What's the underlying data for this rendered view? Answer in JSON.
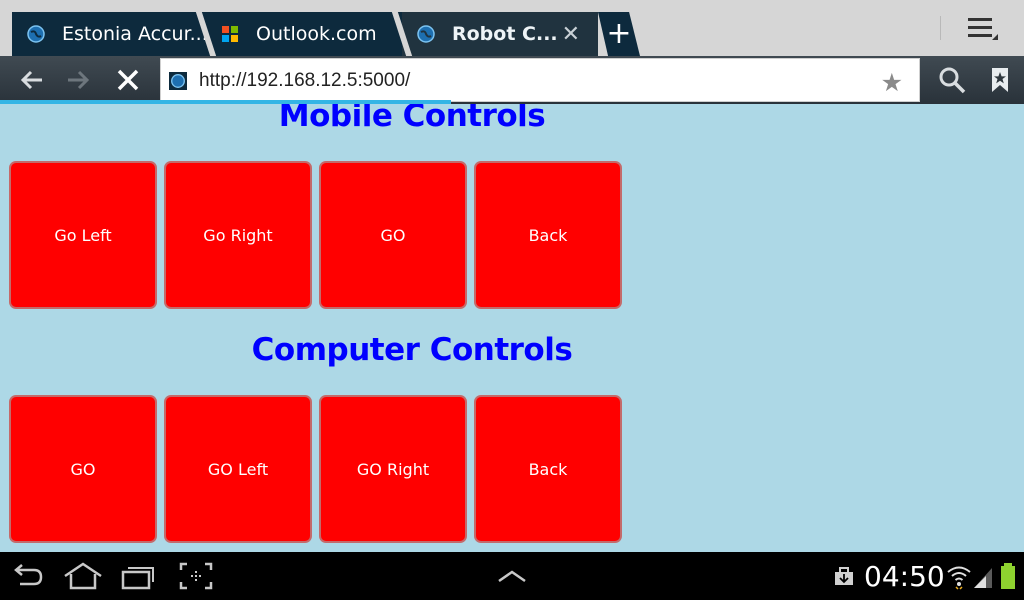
{
  "browser": {
    "tabs": [
      {
        "title": "Estonia Accur...",
        "active": false
      },
      {
        "title": "Outlook.com",
        "active": false
      },
      {
        "title": "Robot C...",
        "active": true
      }
    ],
    "new_tab_symbol": "+",
    "close_tab_symbol": "✕",
    "url": "http://192.168.12.5:5000/",
    "icons": {
      "back": "back-arrow-icon",
      "forward": "forward-arrow-icon",
      "stop": "stop-icon",
      "bookmark_star": "star-icon",
      "search": "search-icon",
      "bookmarks": "bookmarks-icon",
      "menu": "overflow-menu-icon"
    },
    "load_progress": 0.44
  },
  "page": {
    "background": "#add8e6",
    "heading_color": "#0000ff",
    "button_color": "#ff0000",
    "sections": [
      {
        "heading": "Mobile Controls",
        "buttons": [
          "Go Left",
          "Go Right",
          "GO",
          "Back"
        ]
      },
      {
        "heading": "Computer Controls",
        "buttons": [
          "GO",
          "GO Left",
          "GO Right",
          "Back"
        ]
      }
    ]
  },
  "system_bar": {
    "time": "04:50",
    "icons": [
      "back-icon",
      "home-icon",
      "recent-apps-icon",
      "screenshot-icon",
      "up-chevron-icon",
      "notification-icon",
      "wifi-icon",
      "signal-icon",
      "battery-icon"
    ]
  }
}
